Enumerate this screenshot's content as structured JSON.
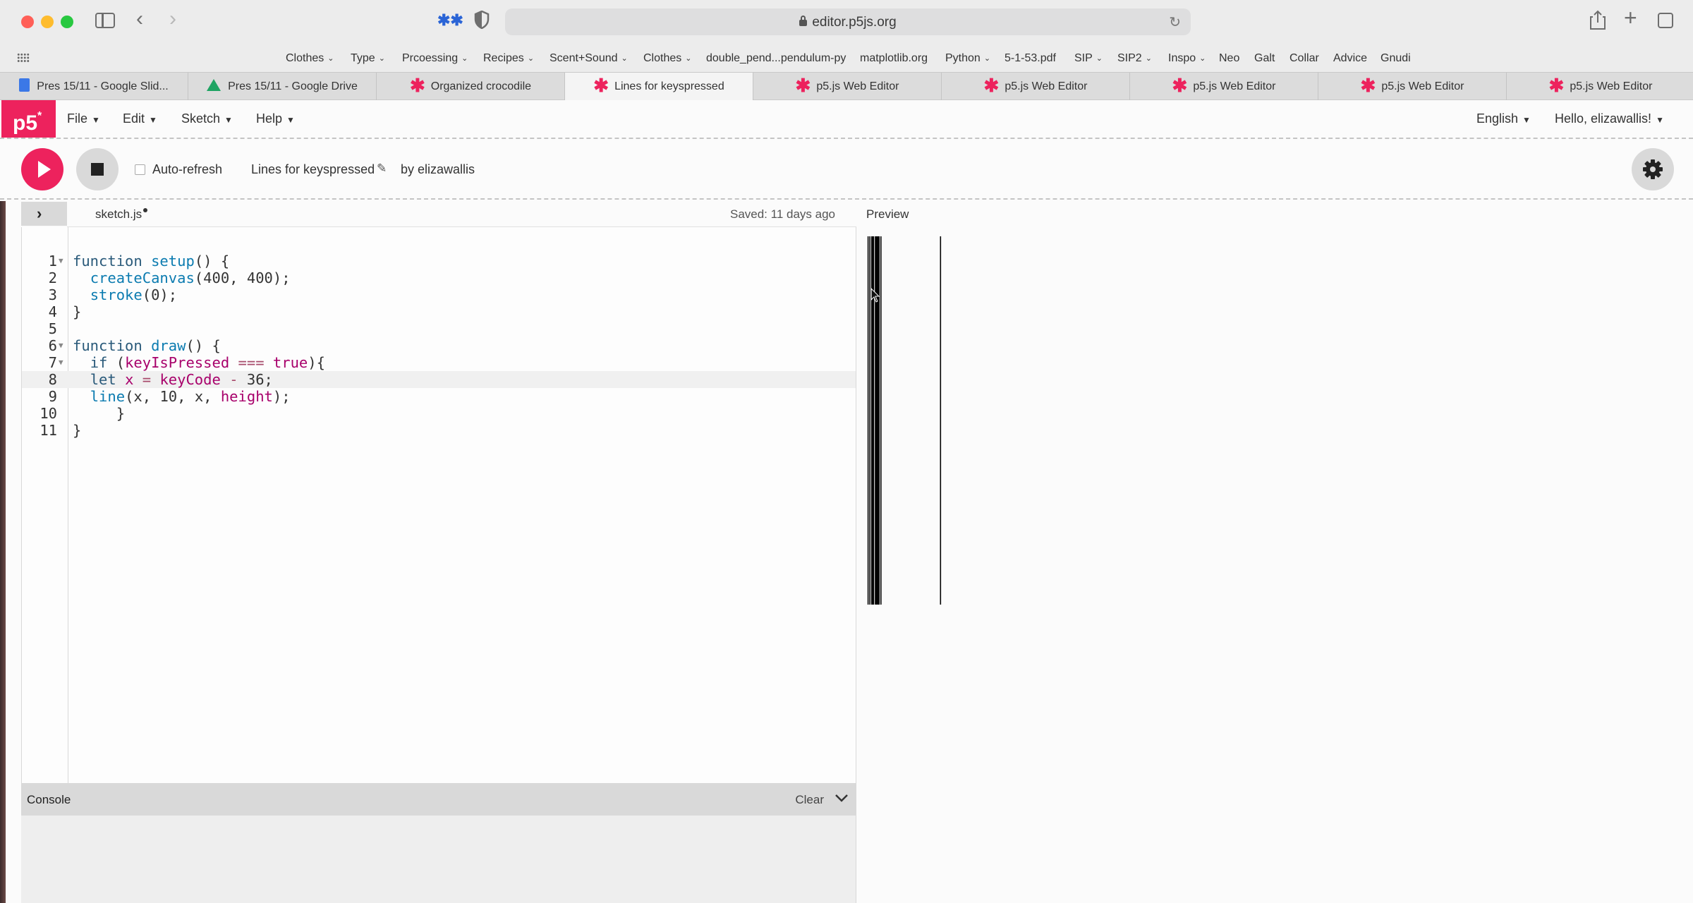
{
  "browser": {
    "url": "editor.p5js.org",
    "favorites": [
      {
        "label": "Clothes",
        "caret": true
      },
      {
        "label": "Type",
        "caret": true
      },
      {
        "label": "Prcoessing",
        "caret": true
      },
      {
        "label": "Recipes",
        "caret": true
      },
      {
        "label": "Scent+Sound",
        "caret": true
      },
      {
        "label": "Clothes",
        "caret": true
      },
      {
        "label": "double_pend...pendulum-py",
        "caret": false
      },
      {
        "label": "matplotlib.org",
        "caret": false
      },
      {
        "label": "Python",
        "caret": true
      },
      {
        "label": "5-1-53.pdf",
        "caret": false
      },
      {
        "label": "SIP",
        "caret": true
      },
      {
        "label": "SIP2",
        "caret": true
      },
      {
        "label": "Inspo",
        "caret": true
      },
      {
        "label": "Neo",
        "caret": false
      },
      {
        "label": "Galt",
        "caret": false
      },
      {
        "label": "Collar",
        "caret": false
      },
      {
        "label": "Advice",
        "caret": false
      },
      {
        "label": "Gnudi",
        "caret": false
      }
    ],
    "tabs": [
      {
        "label": "Pres 15/11 - Google Slid...",
        "icon": "google-slides-icon",
        "active": false
      },
      {
        "label": "Pres 15/11 - Google Drive",
        "icon": "google-drive-icon",
        "active": false
      },
      {
        "label": "Organized crocodile",
        "icon": "p5-star-icon",
        "active": false
      },
      {
        "label": "Lines for keyspressed",
        "icon": "p5-star-icon",
        "active": true
      },
      {
        "label": "p5.js Web Editor",
        "icon": "p5-star-icon",
        "active": false
      },
      {
        "label": "p5.js Web Editor",
        "icon": "p5-star-icon",
        "active": false
      },
      {
        "label": "p5.js Web Editor",
        "icon": "p5-star-icon",
        "active": false
      },
      {
        "label": "p5.js Web Editor",
        "icon": "p5-star-icon",
        "active": false
      },
      {
        "label": "p5.js Web Editor",
        "icon": "p5-star-icon",
        "active": false
      }
    ]
  },
  "nav": {
    "logo": "p5",
    "logo_sup": "*",
    "menus": [
      "File",
      "Edit",
      "Sketch",
      "Help"
    ],
    "language": "English",
    "user": "Hello, elizawallis!"
  },
  "toolbar": {
    "auto_refresh": "Auto-refresh",
    "sketch_name": "Lines for keyspressed",
    "author": "by elizawallis"
  },
  "editor": {
    "filename": "sketch.js",
    "saved": "Saved: 11 days ago",
    "current_line": 8,
    "lines": [
      "function setup() {",
      "  createCanvas(400, 400);",
      "  stroke(0);",
      "}",
      "",
      "function draw() {",
      "  if (keyIsPressed === true){",
      "  let x = keyCode - 36;",
      "  line(x, 10, x, height);",
      "     }",
      "}"
    ],
    "fold_lines": [
      1,
      6,
      7
    ]
  },
  "console": {
    "label": "Console",
    "clear": "Clear"
  },
  "preview": {
    "label": "Preview",
    "line_x_values": [
      2,
      4,
      6,
      7,
      8,
      10,
      11,
      12,
      13,
      14,
      16,
      81
    ],
    "line_y_start": 10,
    "canvas_size": 400
  },
  "colors": {
    "p5_pink": "#ed225d",
    "keyword": "#2a5a7a",
    "function": "#0b7bb0",
    "p5_builtin": "#a8006b"
  }
}
